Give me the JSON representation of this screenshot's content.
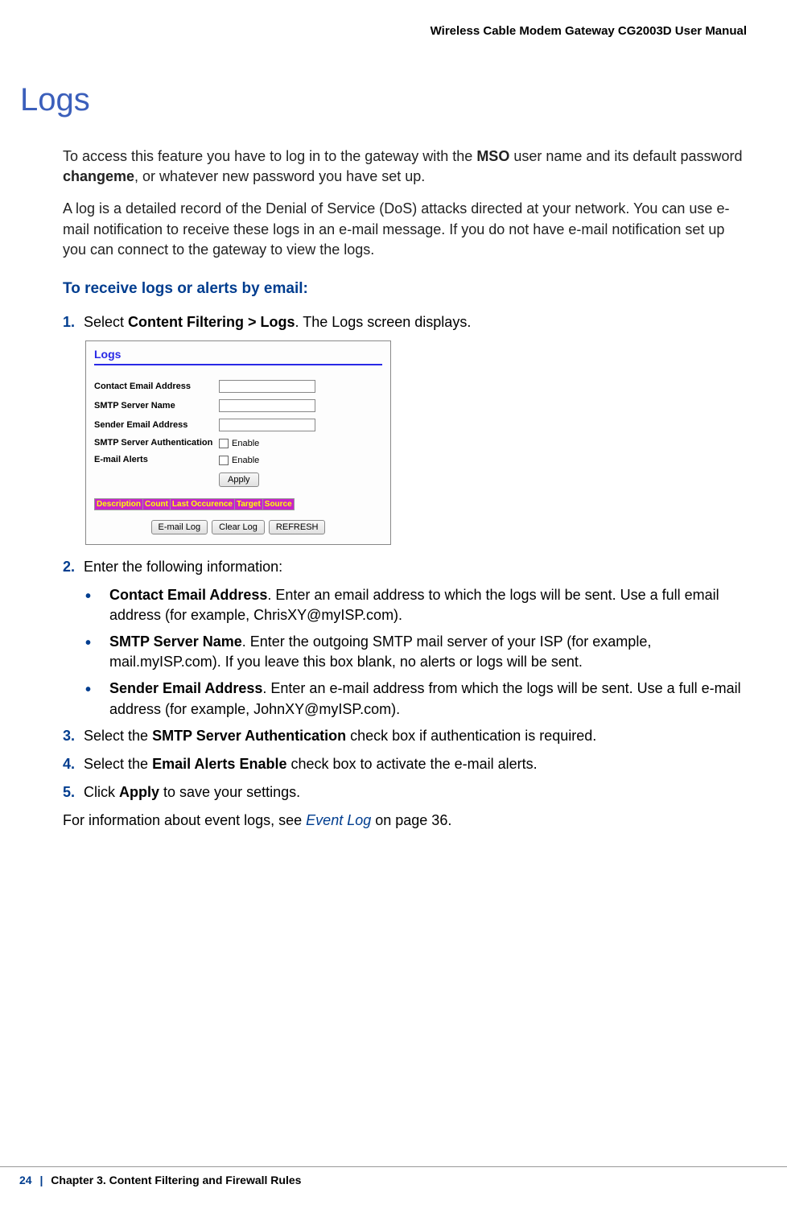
{
  "header": {
    "title": "Wireless Cable Modem Gateway CG2003D User Manual"
  },
  "title": "Logs",
  "intro1_parts": {
    "p1": "To access this feature you have to log in to the gateway with the ",
    "bold1": "MSO",
    "p2": " user name and its default password ",
    "bold2": "changeme",
    "p3": ", or whatever new password you have set up."
  },
  "intro2": "A log is a detailed record of the Denial of Service (DoS) attacks directed at your network. You can use e-mail notification to receive these logs in an e-mail message. If you do not have e-mail notification set up you can connect to the gateway to view the logs.",
  "subheading": "To receive logs or alerts by email:",
  "step1": {
    "num": "1.",
    "text_pre": "Select ",
    "bold": "Content Filtering > Logs",
    "text_post": ". The Logs screen displays."
  },
  "screenshot": {
    "title": "Logs",
    "labels": {
      "contact": "Contact Email Address",
      "smtp_server": "SMTP Server Name",
      "sender": "Sender Email Address",
      "smtp_auth": "SMTP Server Authentication",
      "email_alerts": "E-mail Alerts"
    },
    "enable_label": "Enable",
    "apply_button": "Apply",
    "table_headers": [
      "Description",
      "Count",
      "Last Occurence",
      "Target",
      "Source"
    ],
    "buttons": {
      "email_log": "E-mail Log",
      "clear_log": "Clear Log",
      "refresh": "REFRESH"
    }
  },
  "step2": {
    "num": "2.",
    "text": "Enter the following information:",
    "bullets": [
      {
        "bold": "Contact Email Address",
        "text": ". Enter an email address to which the logs will be sent. Use a full email address (for example, ChrisXY@myISP.com)."
      },
      {
        "bold": "SMTP Server Name",
        "text": ". Enter the outgoing SMTP mail server of your ISP (for example, mail.myISP.com). If you leave this box blank, no alerts or logs will be sent."
      },
      {
        "bold": "Sender Email Address",
        "text": ". Enter an e-mail address from which the logs will be sent. Use a full e-mail address (for example, JohnXY@myISP.com)."
      }
    ]
  },
  "step3": {
    "num": "3.",
    "pre": "Select the ",
    "bold": "SMTP Server Authentication",
    "post": " check box if authentication is required."
  },
  "step4": {
    "num": "4.",
    "pre": "Select the ",
    "bold": "Email Alerts Enable",
    "post": " check box to activate the e-mail alerts."
  },
  "step5": {
    "num": "5.",
    "pre": "Click ",
    "bold": "Apply",
    "post": " to save your settings."
  },
  "final_para": {
    "pre": "For information about event logs, see ",
    "link": "Event Log",
    "post": " on page 36."
  },
  "footer": {
    "page": "24",
    "divider": "|",
    "chapter": "Chapter 3.  Content Filtering and Firewall Rules"
  }
}
